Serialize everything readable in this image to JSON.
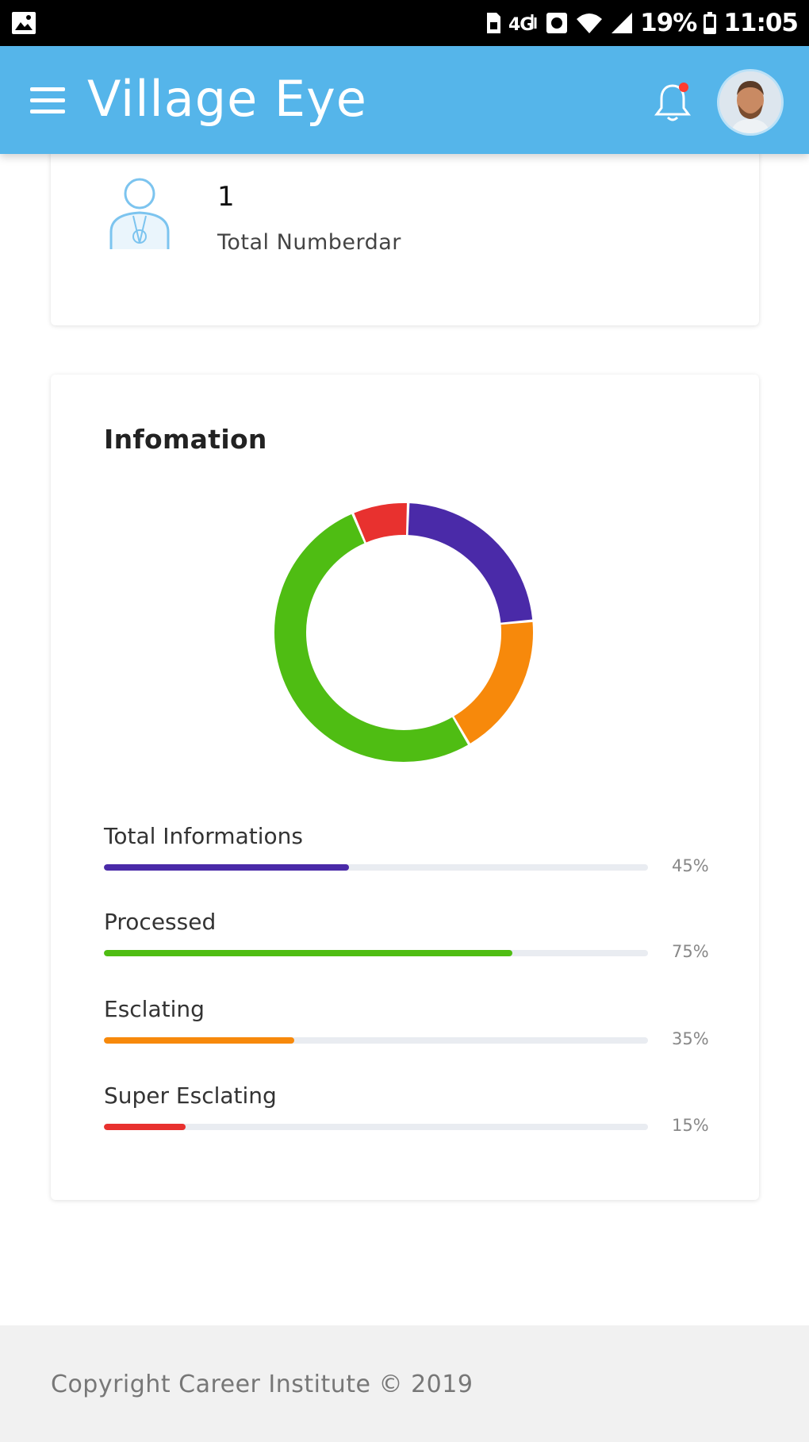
{
  "status_bar": {
    "battery_percent": "19%",
    "time": "11:05"
  },
  "app_bar": {
    "title": "Village Eye",
    "icons": [
      "menu-icon",
      "bell-icon",
      "avatar"
    ],
    "bell_badge_color": "#ff3b30",
    "background_color": "#55b5ea"
  },
  "summary": {
    "total_value": "1",
    "total_label": "Total Numberdar",
    "icon": "user-icon"
  },
  "info_card": {
    "title": "Infomation",
    "donut_segments": [
      {
        "label": "Total Informations",
        "value": 23,
        "color": "#4a2aa8"
      },
      {
        "label": "Escalating",
        "value": 18,
        "color": "#f7890b"
      },
      {
        "label": "Processed",
        "value": 52,
        "color": "#4fbd13"
      },
      {
        "label": "Super Esclating",
        "value": 7,
        "color": "#e8312f"
      }
    ],
    "bars": [
      {
        "label": "Total Informations",
        "percent_text": "45%",
        "value": 45,
        "color": "#4a2aa8"
      },
      {
        "label": "Processed",
        "percent_text": "75%",
        "value": 75,
        "color": "#4fbd13"
      },
      {
        "label": "Esclating",
        "percent_text": "35%",
        "value": 35,
        "color": "#f7890b"
      },
      {
        "label": "Super Esclating",
        "percent_text": "15%",
        "value": 15,
        "color": "#e8312f"
      }
    ]
  },
  "footer": {
    "copyright": "Copyright Career Institute © 2019"
  }
}
